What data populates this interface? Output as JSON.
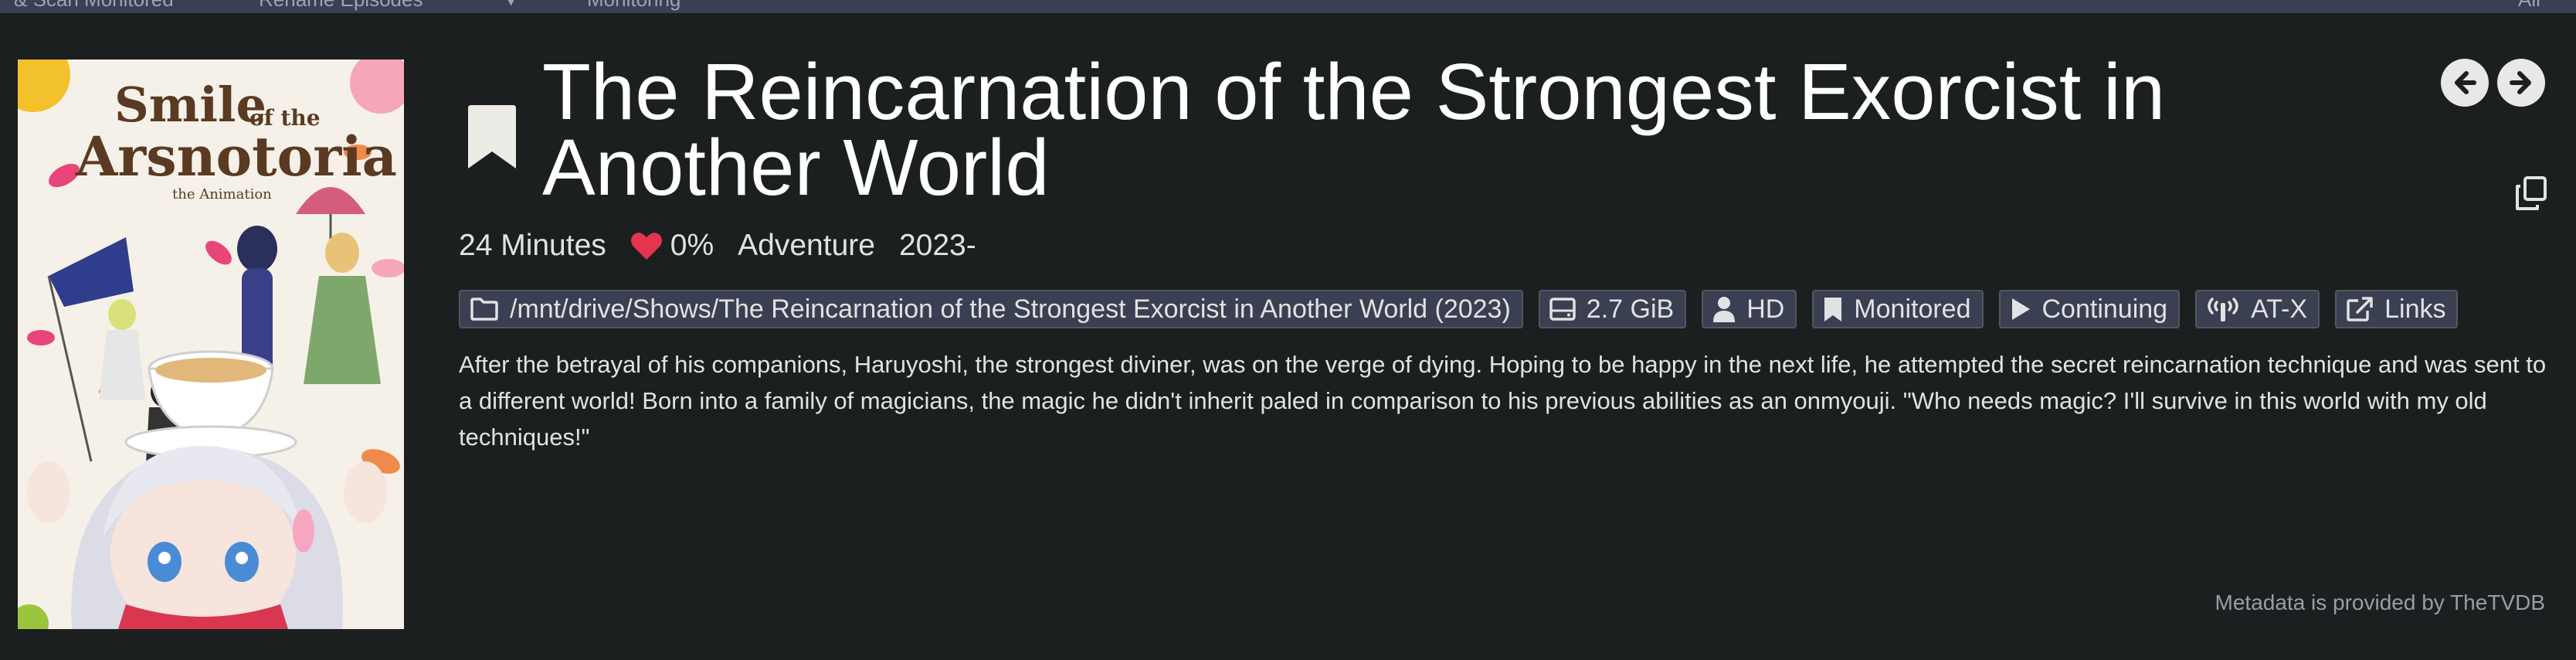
{
  "toolbar": {
    "items": [
      "& Scan  Monitored",
      "Rename  Episodes",
      "▾",
      "Monitoring",
      "All"
    ]
  },
  "poster": {
    "title_line1": "Smile",
    "title_of_the": "of the",
    "title_line2": "Arsnotoria",
    "subtitle": "the Animation"
  },
  "series": {
    "title": "The Reincarnation of the Strongest Exorcist in Another World",
    "runtime": "24 Minutes",
    "rating": "0%",
    "genre": "Adventure",
    "years": "2023-",
    "overview": "After the betrayal of his companions, Haruyoshi, the strongest diviner, was on the verge of dying. Hoping to be happy in the next life, he attempted the secret reincarnation technique and was sent to a different world! Born into a family of magicians, the magic he didn't inherit paled in comparison to his previous abilities as an onmyouji. \"Who needs magic? I'll survive in this world with my old techniques!\""
  },
  "labels": {
    "path": "/mnt/drive/Shows/The Reincarnation of the Strongest Exorcist in Another World (2023)",
    "size": "2.7 GiB",
    "quality": "HD",
    "monitored": "Monitored",
    "status": "Continuing",
    "network": "AT-X",
    "links": "Links"
  },
  "footer": {
    "metadata": "Metadata is provided by TheTVDB"
  },
  "colors": {
    "background": "#1c1f20",
    "label_bg": "#3a3f51",
    "heart": "#e5344e",
    "title": "#ffffff"
  },
  "icons": [
    "bookmark-icon",
    "arrow-left-icon",
    "arrow-right-icon",
    "copy-icon",
    "heart-icon",
    "folder-icon",
    "drive-icon",
    "profile-icon",
    "bookmark-small-icon",
    "play-icon",
    "broadcast-icon",
    "external-link-icon"
  ]
}
